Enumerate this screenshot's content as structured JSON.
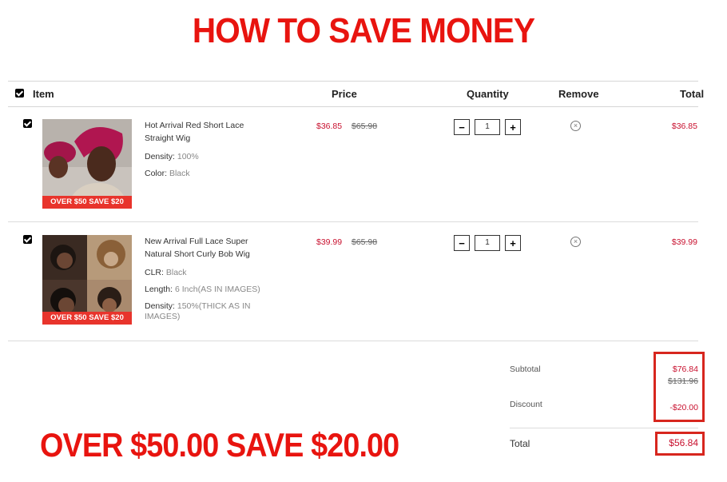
{
  "headline": "HOW TO SAVE MONEY",
  "header": {
    "item": "Item",
    "price": "Price",
    "quantity": "Quantity",
    "remove": "Remove",
    "total": "Total"
  },
  "items": [
    {
      "name": "Hot Arrival Red Short Lace Straight Wig",
      "badge": "OVER $50 SAVE $20",
      "attrs": [
        {
          "label": "Density:",
          "value": "100%"
        },
        {
          "label": "Color:",
          "value": "Black"
        }
      ],
      "price": "$36.85",
      "old_price": "$65.98",
      "qty": "1",
      "total": "$36.85"
    },
    {
      "name": "New Arrival Full Lace Super Natural Short Curly Bob Wig",
      "badge": "OVER $50 SAVE $20",
      "attrs": [
        {
          "label": "CLR:",
          "value": "Black"
        },
        {
          "label": "Length:",
          "value": "6 Inch(AS IN IMAGES)"
        },
        {
          "label": "Density:",
          "value": "150%(THICK AS IN IMAGES)"
        }
      ],
      "price": "$39.99",
      "old_price": "$65.98",
      "qty": "1",
      "total": "$39.99"
    }
  ],
  "summary": {
    "subtotal_label": "Subtotal",
    "subtotal": "$76.84",
    "subtotal_old": "$131.96",
    "discount_label": "Discount",
    "discount": "-$20.00",
    "total_label": "Total",
    "total": "$56.84"
  },
  "promo": "OVER $50.00 SAVE $20.00",
  "qty_minus": "−",
  "qty_plus": "+",
  "remove_glyph": "×",
  "colors": {
    "accent": "#e8140f",
    "price": "#c8102e",
    "badge": "#e8342c"
  }
}
